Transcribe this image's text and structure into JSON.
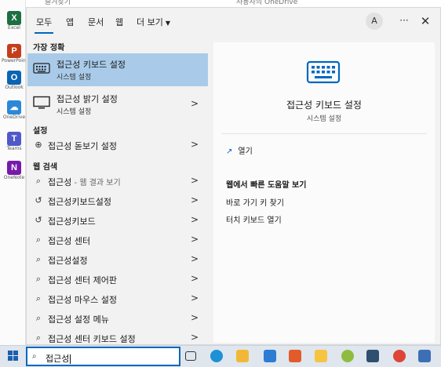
{
  "background": {
    "apps": [
      "Excel",
      "PowerPoint",
      "Outlook",
      "OneDrive",
      "Teams",
      "OneNote"
    ],
    "top_left_text": "즐겨찾기",
    "top_right_text": "사용자의 OneDrive"
  },
  "tabs": [
    {
      "label": "모두"
    },
    {
      "label": "앱"
    },
    {
      "label": "문서"
    },
    {
      "label": "웹"
    },
    {
      "label": "더 보기"
    }
  ],
  "account_initial": "A",
  "more_label": "···",
  "close_label": "✕",
  "best_match": {
    "section": "가장 정확",
    "title": "접근성 키보드 설정",
    "subtitle": "시스템 설정"
  },
  "display_item": {
    "title": "접근성 밝기 설정",
    "subtitle": "시스템 설정"
  },
  "settings_section": "설정",
  "magnifier_item": {
    "label": "접근성 돋보기 설정"
  },
  "web_section": "웹 검색",
  "web_results": [
    {
      "icon": "search-icon",
      "label": "접근성",
      "suffix": " - 웹 결과 보기"
    },
    {
      "icon": "history-icon",
      "label": "접근성키보드설정",
      "suffix": ""
    },
    {
      "icon": "history-icon",
      "label": "접근성키보드",
      "suffix": ""
    },
    {
      "icon": "search-icon",
      "label": "접근성 센터",
      "suffix": ""
    },
    {
      "icon": "search-icon",
      "label": "접근성설정",
      "suffix": ""
    },
    {
      "icon": "search-icon",
      "label": "접근성 센터 제어판",
      "suffix": ""
    },
    {
      "icon": "search-icon",
      "label": "접근성 마우스 설정",
      "suffix": ""
    },
    {
      "icon": "search-icon",
      "label": "접근성 설정 메뉴",
      "suffix": ""
    },
    {
      "icon": "search-icon",
      "label": "접근성 센터 키보드 설정",
      "suffix": ""
    }
  ],
  "preview": {
    "title": "접근성 키보드 설정",
    "subtitle": "시스템 설정",
    "open_label": "열기",
    "help_heading": "웹에서 빠른 도움말 보기",
    "help_links": [
      "바로 가기 키 찾기",
      "터치 키보드 열기"
    ]
  },
  "search": {
    "value": "접근성"
  },
  "colors": {
    "accent": "#0067c0",
    "selected_row": "#a9cbe9"
  }
}
